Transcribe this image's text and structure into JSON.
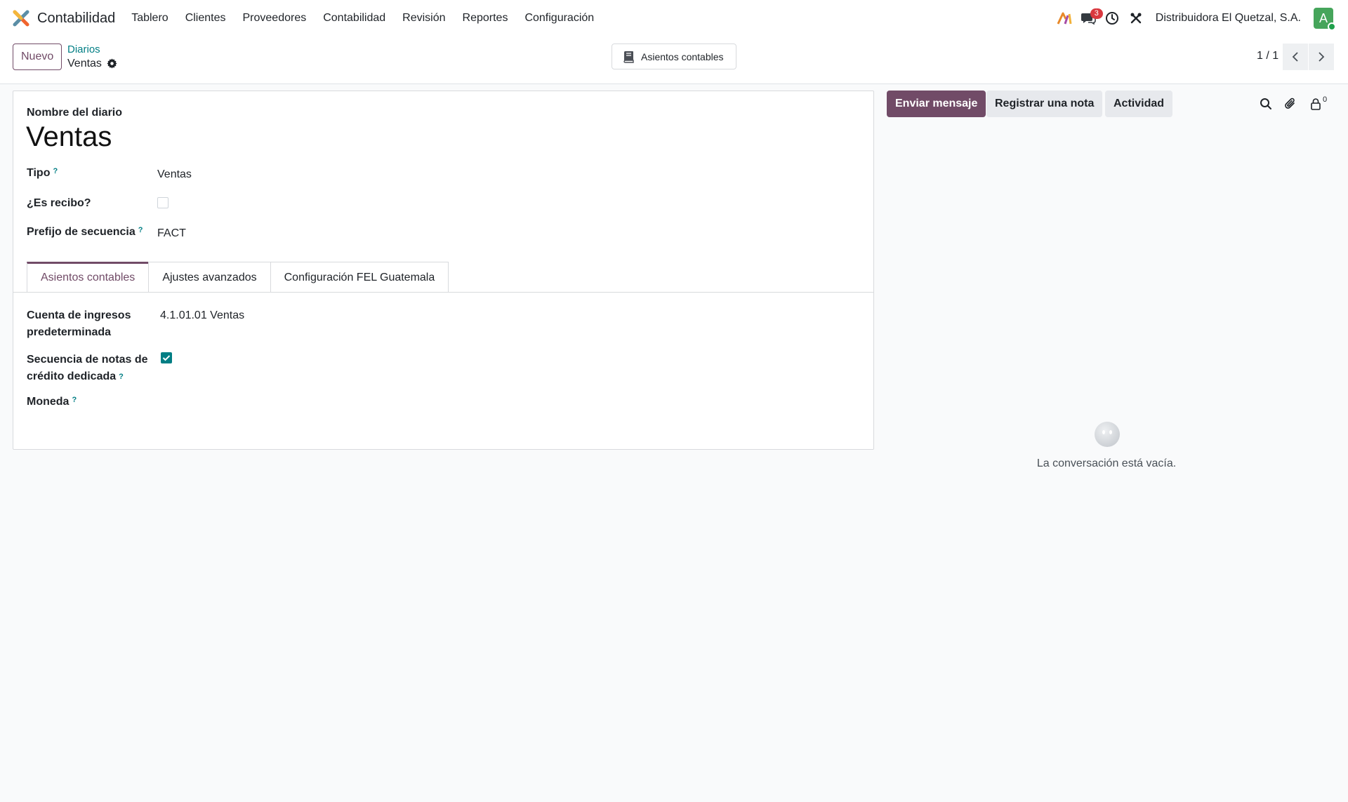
{
  "navbar": {
    "app_name": "Contabilidad",
    "logo_icon": "odoo-x-logo-icon",
    "menu": [
      "Tablero",
      "Clientes",
      "Proveedores",
      "Contabilidad",
      "Revisión",
      "Reportes",
      "Configuración"
    ],
    "messages_badge": "3",
    "company": "Distribuidora El Quetzal, S.A.",
    "avatar_initial": "A"
  },
  "control_panel": {
    "new_button": "Nuevo",
    "breadcrumb_parent": "Diarios",
    "breadcrumb_current": "Ventas",
    "smart_button": "Asientos contables",
    "pager": "1 / 1"
  },
  "form": {
    "name_label": "Nombre del diario",
    "name_value": "Ventas",
    "fields": {
      "type_label": "Tipo",
      "type_value": "Ventas",
      "is_receipt_label": "¿Es recibo?",
      "is_receipt_checked": false,
      "sequence_prefix_label": "Prefijo de secuencia",
      "sequence_prefix_value": "FACT"
    },
    "help_mark": "?",
    "tabs": [
      "Asientos contables",
      "Ajustes avanzados",
      "Configuración FEL Guatemala"
    ],
    "active_tab": 0,
    "tab_fields": {
      "income_account_label_1": "Cuenta de ingresos",
      "income_account_label_2": "predeterminada",
      "income_account_value": "4.1.01.01 Ventas",
      "credit_note_seq_label_1": "Secuencia de notas de",
      "credit_note_seq_label_2": "crédito dedicada",
      "credit_note_seq_checked": true,
      "currency_label": "Moneda"
    }
  },
  "chatter": {
    "send_message": "Enviar mensaje",
    "log_note": "Registrar una nota",
    "activity": "Actividad",
    "followers_count": "0",
    "empty_text": "La conversación está vacía."
  },
  "colors": {
    "primary": "#714b67",
    "accent": "#017e84",
    "badge": "#d9383f",
    "avatar": "#46a55b"
  }
}
